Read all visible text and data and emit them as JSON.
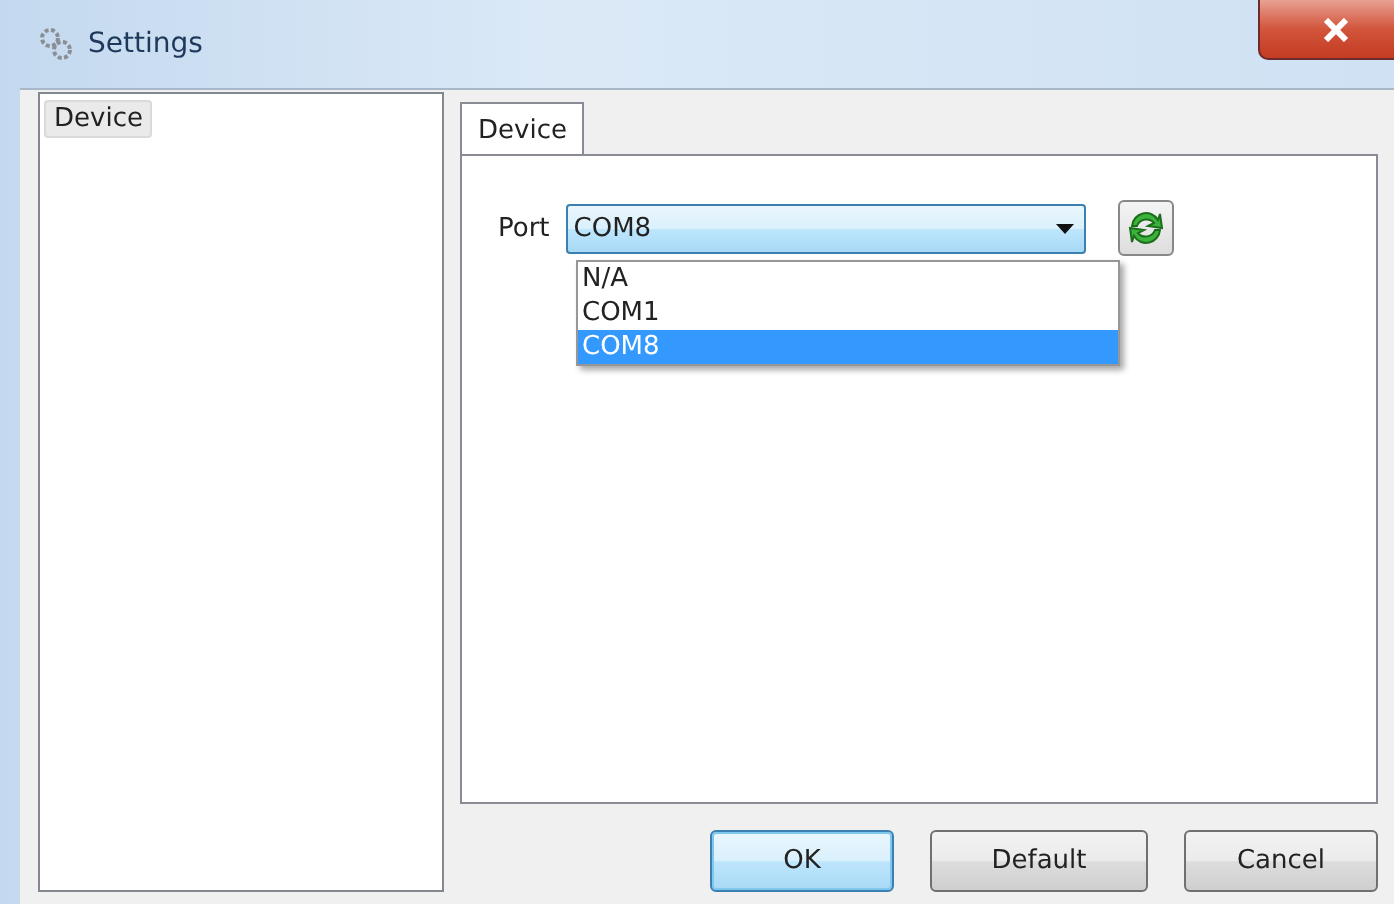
{
  "window": {
    "title": "Settings"
  },
  "sidebar": {
    "items": [
      {
        "label": "Device",
        "selected": true
      }
    ]
  },
  "tabs": [
    {
      "label": "Device",
      "selected": true
    }
  ],
  "port": {
    "label": "Port",
    "value": "COM8",
    "expanded": true,
    "options": [
      {
        "label": "N/A",
        "selected": false
      },
      {
        "label": "COM1",
        "selected": false
      },
      {
        "label": "COM8",
        "selected": true
      }
    ]
  },
  "buttons": [
    {
      "label": "OK",
      "default": true
    },
    {
      "label": "Default",
      "default": false
    },
    {
      "label": "Cancel",
      "default": false
    }
  ]
}
